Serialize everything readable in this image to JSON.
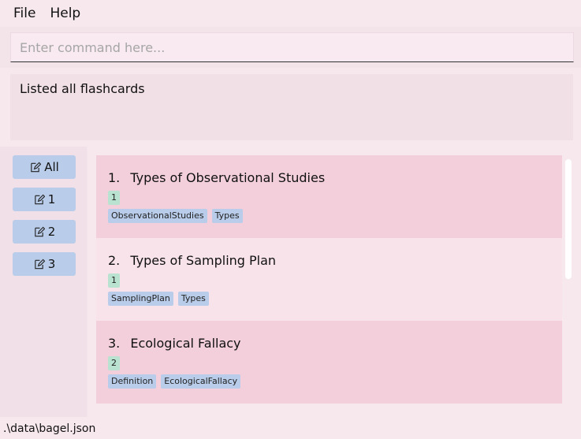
{
  "menu": {
    "file": "File",
    "help": "Help"
  },
  "command": {
    "placeholder": "Enter command here...",
    "value": ""
  },
  "result": {
    "message": "Listed all flashcards"
  },
  "decks": [
    {
      "label": "All",
      "icon": "edit-note-icon"
    },
    {
      "label": "1",
      "icon": "edit-note-icon"
    },
    {
      "label": "2",
      "icon": "edit-note-icon"
    },
    {
      "label": "3",
      "icon": "edit-note-icon"
    }
  ],
  "flashcards": [
    {
      "index": "1.",
      "title": "Types of Observational Studies",
      "weight": "1",
      "tags": [
        "ObservationalStudies",
        "Types"
      ]
    },
    {
      "index": "2.",
      "title": "Types of Sampling Plan",
      "weight": "1",
      "tags": [
        "SamplingPlan",
        "Types"
      ]
    },
    {
      "index": "3.",
      "title": "Ecological Fallacy",
      "weight": "2",
      "tags": [
        "Definition",
        "EcologicalFallacy"
      ]
    }
  ],
  "status": {
    "file_path": ".\\data\\bagel.json"
  },
  "colors": {
    "background": "#f7e8ee",
    "card_odd": "#f2cfdb",
    "card_even": "#f8e3ea",
    "deck_button": "#b9cdea",
    "weight_tag": "#b9e3d0",
    "topic_tag": "#b9cdea"
  }
}
